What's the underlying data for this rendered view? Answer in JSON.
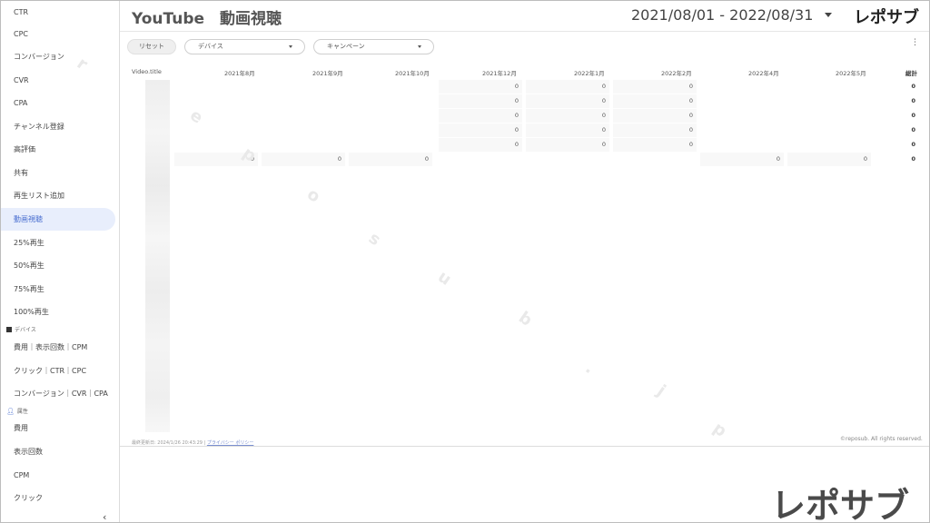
{
  "sidebar": {
    "items": [
      {
        "label": "CTR"
      },
      {
        "label": "CPC"
      },
      {
        "label": "コンバージョン"
      },
      {
        "label": "CVR"
      },
      {
        "label": "CPA"
      },
      {
        "label": "チャンネル登録"
      },
      {
        "label": "高評価"
      },
      {
        "label": "共有"
      },
      {
        "label": "再生リスト追加"
      },
      {
        "label": "動画視聴",
        "active": true
      },
      {
        "label": "25%再生"
      },
      {
        "label": "50%再生"
      },
      {
        "label": "75%再生"
      },
      {
        "label": "100%再生"
      }
    ],
    "section_device": "デバイス",
    "device_items": [
      {
        "label": "費用｜表示回数｜CPM"
      },
      {
        "label": "クリック｜CTR｜CPC"
      },
      {
        "label": "コンバージョン｜CVR｜CPA"
      }
    ],
    "section_attr": "属性",
    "attr_items": [
      {
        "label": "費用"
      },
      {
        "label": "表示回数"
      },
      {
        "label": "CPM"
      },
      {
        "label": "クリック"
      }
    ],
    "collapse_icon": "chevron-left-icon"
  },
  "header": {
    "title": "YouTube　動画視聴",
    "date_range": "2021/08/01 - 2022/08/31",
    "brand": "レポサブ"
  },
  "filters": {
    "reset_label": "リセット",
    "device_label": "デバイス",
    "campaign_label": "キャンペーン"
  },
  "table": {
    "first_col": "Video.title",
    "columns": [
      "2021年8月",
      "2021年9月",
      "2021年10月",
      "2021年12月",
      "2022年1月",
      "2022年2月",
      "2022年4月",
      "2022年5月",
      "総計"
    ],
    "rows": [
      [
        "",
        "",
        "",
        "0",
        "0",
        "0",
        "",
        "",
        "0"
      ],
      [
        "",
        "",
        "",
        "0",
        "0",
        "0",
        "",
        "",
        "0"
      ],
      [
        "",
        "",
        "",
        "0",
        "0",
        "0",
        "",
        "",
        "0"
      ],
      [
        "",
        "",
        "",
        "0",
        "0",
        "0",
        "",
        "",
        "0"
      ],
      [
        "",
        "",
        "",
        "0",
        "0",
        "0",
        "",
        "",
        "0"
      ],
      [
        "0",
        "0",
        "0",
        "",
        "",
        "",
        "0",
        "0",
        "0"
      ]
    ]
  },
  "footer": {
    "updated": "最終更新日: 2024/1/26 20:43:29",
    "separator": "|",
    "privacy": "プライバシー ポリシー",
    "copyright": "©reposub. All rights reserved."
  },
  "watermark": [
    "r",
    "e",
    "p",
    "o",
    "s",
    "u",
    "b",
    ".",
    "j",
    "p"
  ],
  "big_brand": "レポサブ"
}
